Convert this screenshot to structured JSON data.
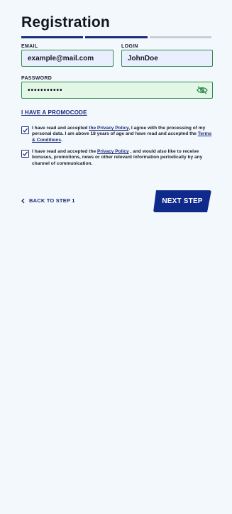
{
  "header": {
    "title": "Registration",
    "progress_steps_total": 3,
    "progress_steps_done": 2
  },
  "form": {
    "email_label": "EMAIL",
    "email_value": "example@mail.com",
    "login_label": "LOGIN",
    "login_value": "JohnDoe",
    "password_label": "PASSWORD",
    "password_value": "•••••••••••",
    "promocode_link": "I HAVE A PROMOCODE"
  },
  "consents": {
    "privacy": {
      "checked": true,
      "text_before": "I have read and accepted ",
      "link1": "the Privacy Policy",
      "text_middle": ", I agree with the processing of my personal data. I am above 18 years of age and have read and accepted the ",
      "link2": "Terms & Conditions",
      "text_after": "."
    },
    "marketing": {
      "checked": true,
      "text_before": "I have read and accepted the ",
      "link1": "Privacy Policy",
      "text_after": " , and would also like to receive bonuses, promotions, news or other relevant information periodically by any channel of communication."
    }
  },
  "footer": {
    "back_label": "BACK TO STEP 1",
    "next_label": "NEXT STEP"
  },
  "colors": {
    "accent": "#1b2c7a",
    "button": "#0f2a8a",
    "valid_border": "#2e8a4a",
    "background": "#f3f8fc"
  },
  "icons": {
    "password_toggle": "eye-off-icon",
    "back": "chevron-left-icon",
    "checkbox": "check-icon"
  }
}
